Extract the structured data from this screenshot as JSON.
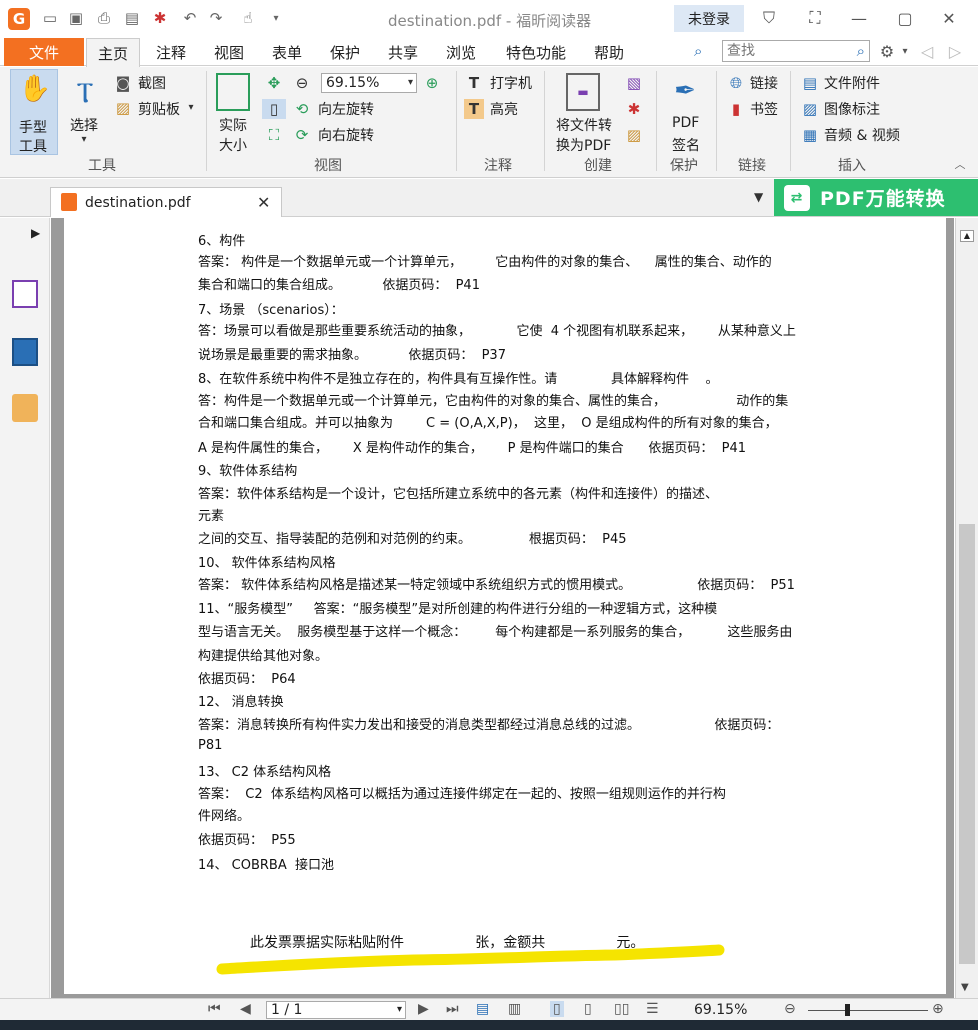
{
  "window": {
    "title": "destination.pdf - 福昕阅读器",
    "login_label": "未登录",
    "controls": [
      "minimize-icon",
      "restore-icon",
      "close-icon"
    ]
  },
  "menu": {
    "file": "文件",
    "tabs": [
      "主页",
      "注释",
      "视图",
      "表单",
      "保护",
      "共享",
      "浏览",
      "特色功能",
      "帮助"
    ],
    "active_tab": "主页",
    "search_placeholder": "查找"
  },
  "ribbon": {
    "tools": {
      "hand": "手型\n工具",
      "hand_line1": "手型",
      "hand_line2": "工具",
      "select": "选择",
      "screenshot": "截图",
      "clipboard": "剪贴板",
      "group": "工具"
    },
    "view": {
      "actual_line1": "实际",
      "actual_line2": "大小",
      "zoom": "69.15%",
      "rotate_left": "向左旋转",
      "rotate_right": "向右旋转",
      "group": "视图"
    },
    "comment": {
      "typewriter": "打字机",
      "highlight": "高亮",
      "group": "注释"
    },
    "create": {
      "convert_line1": "将文件转",
      "convert_line2": "换为PDF",
      "group": "创建"
    },
    "protect": {
      "sign_line1": "PDF",
      "sign_line2": "签名",
      "group": "保护"
    },
    "links": {
      "link": "链接",
      "bookmark": "书签",
      "group": "链接"
    },
    "insert": {
      "attachment": "文件附件",
      "image": "图像标注",
      "media": "音频 & 视频",
      "group": "插入"
    }
  },
  "document_tab": {
    "name": "destination.pdf",
    "banner": "PDF万能转换"
  },
  "page_lines": [
    "6、构件",
    "答案： 构件是一个数据单元或一个计算单元，        它由构件的对象的集合、    属性的集合、动作的",
    "集合和端口的集合组成。          依据页码：  P41",
    "7、场景 （scenarios）：",
    "答：场景可以看做是那些重要系统活动的抽象，           它使  4 个视图有机联系起来，      从某种意义上",
    "说场景是最重要的需求抽象。          依据页码：  P37",
    "8、在软件系统中构件不是独立存在的，构件具有互操作性。请             具体解释构件    。",
    "答：构件是一个数据单元或一个计算单元，它由构件的对象的集合、属性的集合，                 动作的集",
    "合和端口集合组成。并可以抽象为        C = (O,A,X,P)，  这里，  O 是组成构件的所有对象的集合，",
    "A 是构件属性的集合，      X 是构件动作的集合，      P 是构件端口的集合      依据页码：  P41",
    "9、软件体系结构",
    "答案：软件体系结构是一个设计，它包括所建立系统中的各元素（构件和连接件）的描述、",
    "元素",
    "之间的交互、指导装配的范例和对范例的约束。              根据页码：  P45",
    "10、 软件体系结构风格",
    "答案： 软件体系结构风格是描述某一特定领域中系统组织方式的惯用模式。                依据页码：  P51",
    "11、“服务模型”     答案：“服务模型”是对所创建的构件进行分组的一种逻辑方式，这种模",
    "型与语言无关。  服务模型基于这样一个概念：       每个构建都是一系列服务的集合，         这些服务由",
    "构建提供给其他对象。",
    "依据页码：  P64",
    "12、 消息转换",
    "答案：消息转换所有构件实力发出和接受的消息类型都经过消息总线的过滤。                  依据页码：",
    "P81",
    "13、 C2 体系结构风格",
    "答案：  C2  体系结构风格可以概括为通过连接件绑定在一起的、按照一组规则运作的并行构",
    "件网络。",
    "依据页码：  P55",
    "14、 COBRBA  接口池"
  ],
  "footnote": "此发票票据实际粘贴附件                张，金额共                元。",
  "status": {
    "page": "1 / 1",
    "zoom": "69.15%"
  },
  "colors": {
    "accent": "#f37021",
    "banner": "#2dbf70",
    "highlight": "#f5e400"
  }
}
